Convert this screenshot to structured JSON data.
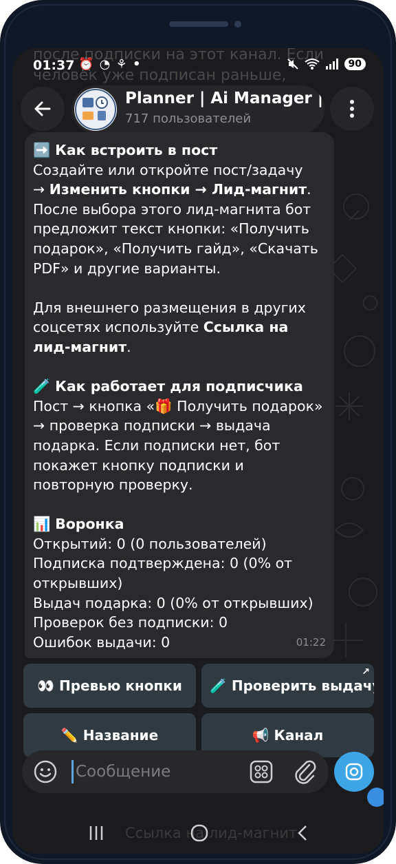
{
  "status_bar": {
    "time": "01:37",
    "notification_icons": "⏰ ◔ ⚘ •",
    "battery": "90"
  },
  "background_ghost": {
    "top_text": "после подписки на этот канал. Если человек уже подписан раньше,",
    "bottom_text": "Ссылка на лид-магнит"
  },
  "header": {
    "back_icon": "arrow-left-icon",
    "title": "Planner | Ai Manager | Lead",
    "subtitle": "717 пользователей",
    "menu_icon": "more-vertical-icon"
  },
  "message": {
    "embed": {
      "heading_emoji": "➡️",
      "heading": "Как встроить в пост",
      "line1": "Создайте или откройте пост/задачу",
      "line2_arrow": "→ ",
      "line2_bold": "Изменить кнопки → Лид-магнит",
      "line2_end": ".",
      "rest": "После выбора этого лид-магнита бот предложит текст кнопки: «Получить подарок», «Получить гайд», «Скачать PDF» и другие варианты."
    },
    "external": {
      "text": "Для внешнего размещения в других соцсетях используйте ",
      "bold": "Ссылка на лид-магнит",
      "end": "."
    },
    "subscriber": {
      "heading_emoji": "🧪",
      "heading": "Как работает для подписчика",
      "text_before": "Пост → кнопка «",
      "gift_emoji": "🎁",
      "text_after": " Получить подарок» → проверка подписки → выдача подарка. Если подписки нет, бот покажет кнопку подписки и повторную проверку."
    },
    "funnel": {
      "heading_emoji": "📊",
      "heading": "Воронка",
      "lines": [
        "Открытий: 0 (0 пользователей)",
        "Подписка подтверждена: 0 (0% от открывших)",
        "Выдач подарка: 0 (0% от открывших)",
        "Проверок без подписки: 0",
        "Ошибок выдачи: 0"
      ]
    },
    "time": "01:22"
  },
  "inline_keyboard": {
    "preview": "👀 Превью кнопки",
    "check": "🧪 Проверить выдачу",
    "check_arrow": "↗",
    "name": "✏️ Название",
    "channel": "📢 Канал"
  },
  "input_bar": {
    "placeholder": "Сообщение"
  },
  "colors": {
    "bubble": "#2a2a2c",
    "keyboard_button": "#2f3a41",
    "accent": "#3ea6e6"
  }
}
